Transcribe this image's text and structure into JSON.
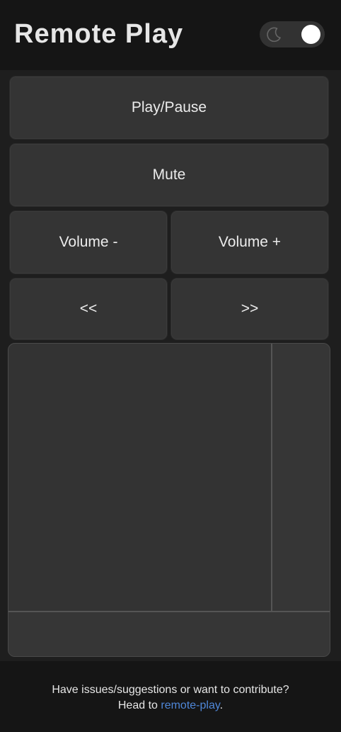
{
  "header": {
    "title": "Remote Play",
    "theme_toggle": {
      "icon": "moon-icon",
      "state": "on"
    }
  },
  "controls": {
    "play_pause": "Play/Pause",
    "mute": "Mute",
    "volume_down": "Volume -",
    "volume_up": "Volume +",
    "rewind": "<<",
    "forward": ">>"
  },
  "footer": {
    "line1": "Have issues/suggestions or want to contribute?",
    "line2_prefix": "Head to ",
    "link_text": "remote-play",
    "line2_suffix": "."
  },
  "colors": {
    "background": "#1e1e1e",
    "header_bg": "#151515",
    "button_bg": "#343434",
    "text": "#ececec",
    "link": "#4f87d8"
  }
}
